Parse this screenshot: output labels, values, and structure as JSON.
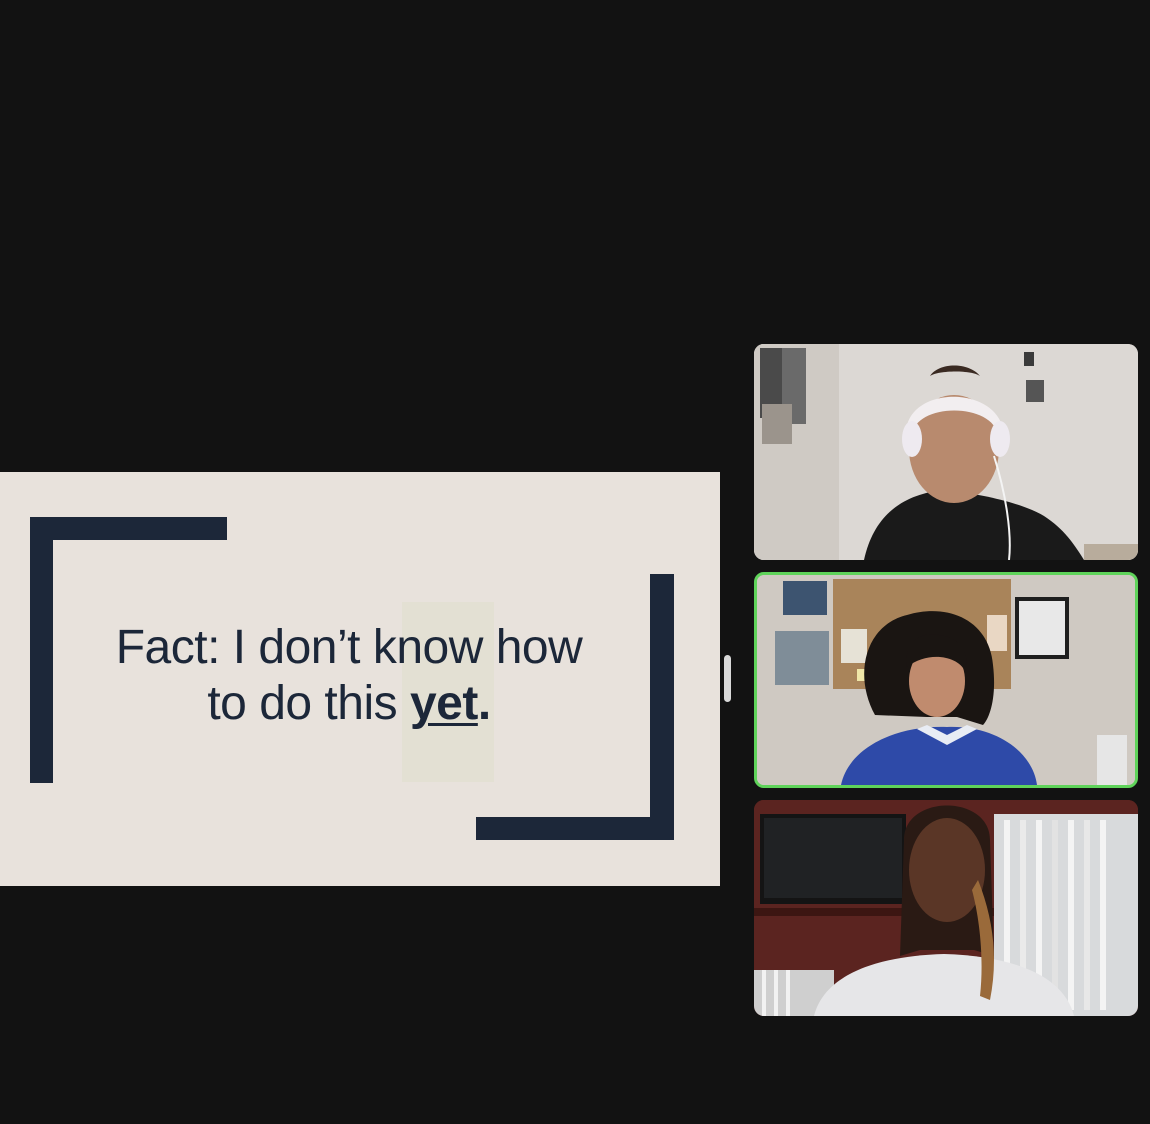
{
  "slide": {
    "line1": "Fact: I don’t know how",
    "line2_prefix": "to do this ",
    "emphasis": "yet",
    "period": "."
  },
  "colors": {
    "background": "#121212",
    "slide_bg": "#e8e2dc",
    "slide_accent": "#1c2739",
    "active_speaker_border": "#5fd35a"
  },
  "participants": [
    {
      "tile": "participant-video-1",
      "active_speaker": false
    },
    {
      "tile": "participant-video-2",
      "active_speaker": true
    },
    {
      "tile": "participant-video-3",
      "active_speaker": false
    }
  ]
}
